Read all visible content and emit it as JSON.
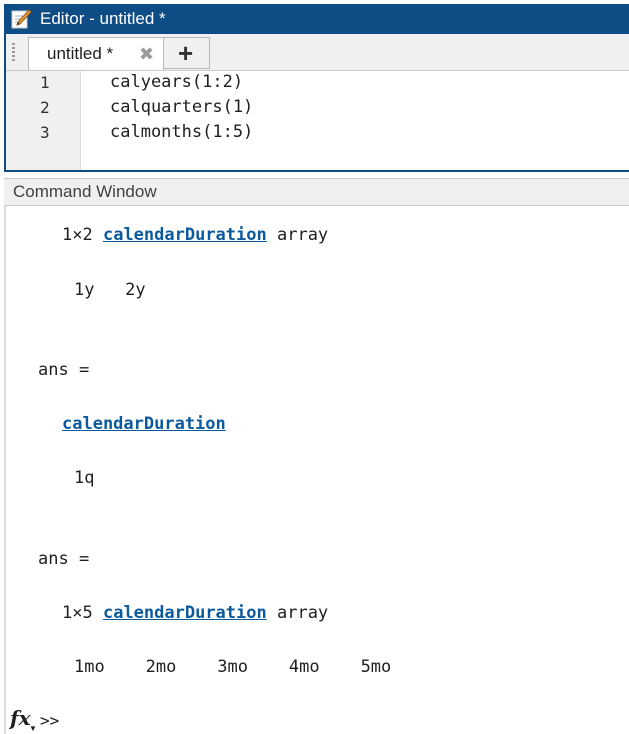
{
  "editor": {
    "title": "Editor - untitled *",
    "tab_label": "untitled *",
    "close_glyph": "✖",
    "add_glyph": "+",
    "lines": [
      {
        "num": "1",
        "code": "calyears(1:2)"
      },
      {
        "num": "2",
        "code": "calquarters(1)"
      },
      {
        "num": "3",
        "code": "calmonths(1:5)"
      }
    ]
  },
  "command_window": {
    "title": "Command Window",
    "out1": {
      "size": "1×2",
      "class": "calendarDuration",
      "suffix": "array",
      "values": "1y   2y"
    },
    "ans_label": "ans =",
    "out2": {
      "class": "calendarDuration",
      "values": "1q"
    },
    "out3": {
      "size": "1×5",
      "class": "calendarDuration",
      "suffix": "array",
      "values": "1mo    2mo    3mo    4mo    5mo"
    },
    "fx_label": "fx",
    "prompt": ">>"
  },
  "icons": {
    "editor": "pencil-edit-icon",
    "close": "close-icon",
    "add": "plus-icon",
    "function": "fx-icon"
  },
  "colors": {
    "title_bar": "#0e4c86",
    "link": "#0b5a9e"
  }
}
